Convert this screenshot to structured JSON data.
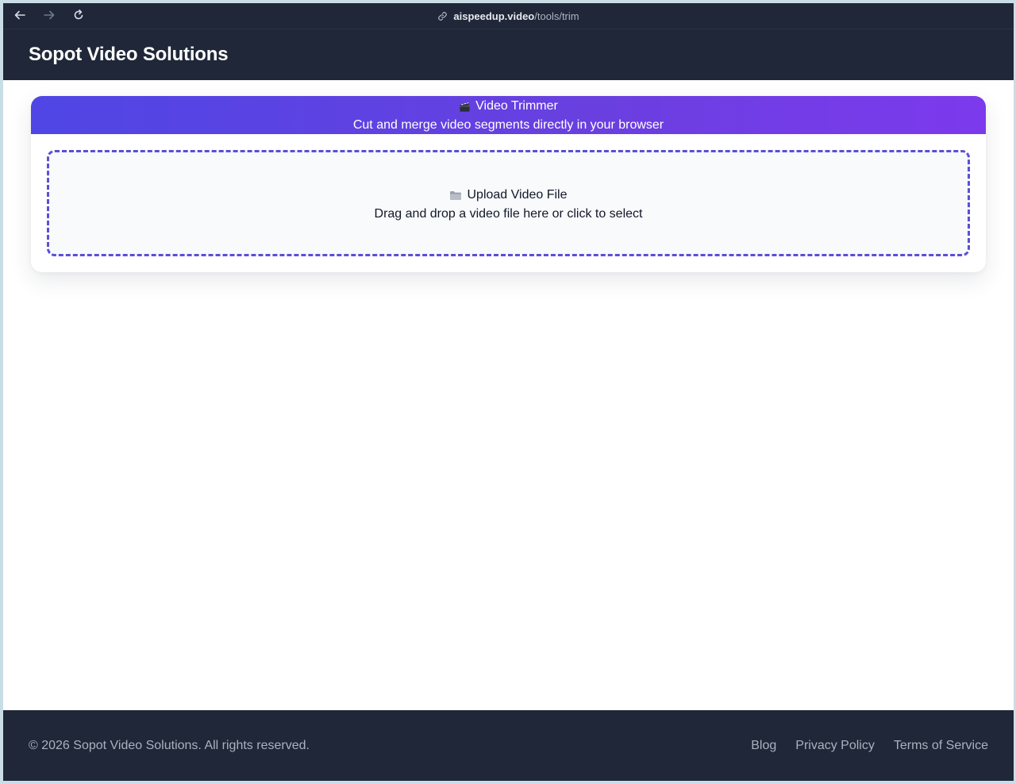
{
  "browser": {
    "url_host": "aispeedup.video",
    "url_path": "/tools/trim",
    "back_icon": "arrow-left-icon",
    "forward_icon": "arrow-right-icon",
    "reload_icon": "reload-icon",
    "link_icon": "link-icon"
  },
  "header": {
    "title": "Sopot Video Solutions"
  },
  "tool": {
    "icon": "clapperboard-icon",
    "title": "Video Trimmer",
    "subtitle": "Cut and merge video segments directly in your browser",
    "accent_start": "#4f46e5",
    "accent_end": "#7c3aed"
  },
  "upload": {
    "icon": "folder-icon",
    "title": "Upload Video File",
    "hint": "Drag and drop a video file here or click to select",
    "border_color": "#5b4fd6"
  },
  "footer": {
    "copyright": "© 2026 Sopot Video Solutions. All rights reserved.",
    "links": [
      {
        "label": "Blog"
      },
      {
        "label": "Privacy Policy"
      },
      {
        "label": "Terms of Service"
      }
    ]
  },
  "colors": {
    "dark_bg": "#1f2738"
  }
}
